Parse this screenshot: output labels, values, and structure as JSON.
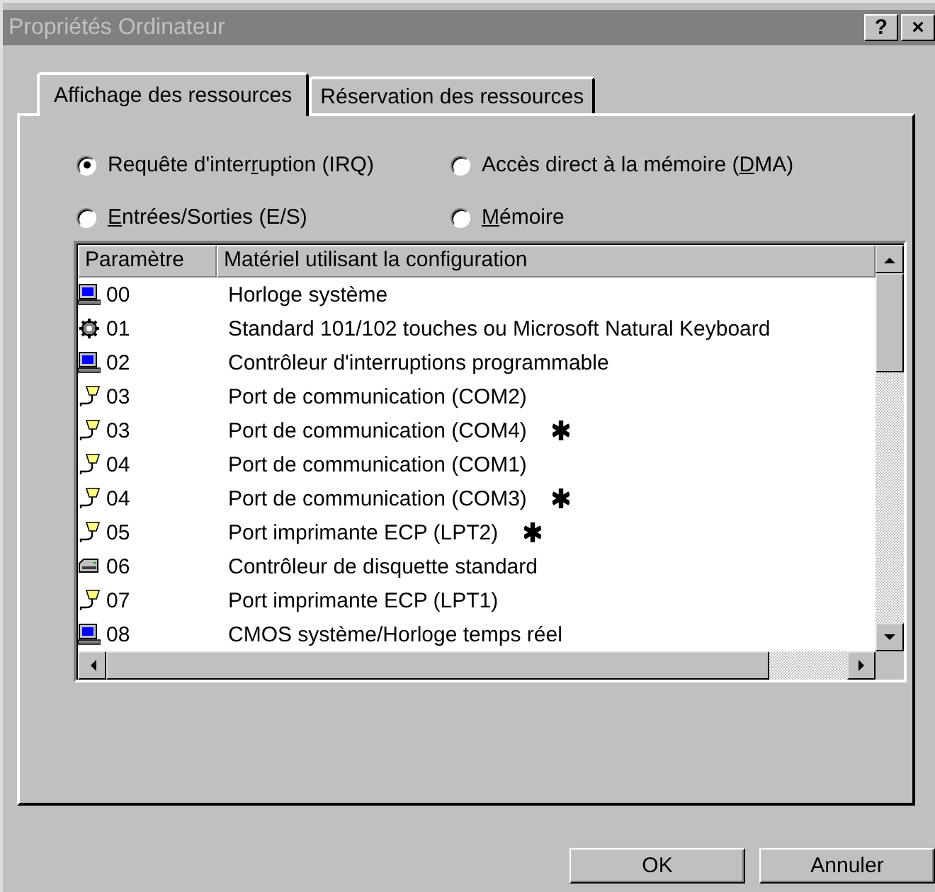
{
  "window": {
    "title": "Propriétés Ordinateur",
    "help_button": "?",
    "close_button": "×"
  },
  "tabs": [
    {
      "label": "Affichage des ressources",
      "selected": true
    },
    {
      "label": "Réservation des ressources",
      "selected": false
    }
  ],
  "options": [
    {
      "before": "Requête d'inter",
      "key": "r",
      "after": "uption (IRQ)",
      "selected": true
    },
    {
      "before": "Accès direct à la mémoire (",
      "key": "D",
      "after": "MA)",
      "selected": false
    },
    {
      "key": "E",
      "after": "ntrées/Sorties (E/S)",
      "selected": false
    },
    {
      "key": "M",
      "after": "émoire",
      "selected": false
    }
  ],
  "table": {
    "columns": [
      "Paramètre",
      "Matériel utilisant la configuration"
    ],
    "rows": [
      {
        "kind": "computer",
        "setting": "00",
        "device": "Horloge système",
        "conflict": false
      },
      {
        "kind": "keyboard",
        "setting": "01",
        "device": "Standard 101/102 touches ou Microsoft Natural Keyboard",
        "conflict": false
      },
      {
        "kind": "computer",
        "setting": "02",
        "device": "Contrôleur d'interruptions programmable",
        "conflict": false
      },
      {
        "kind": "port",
        "setting": "03",
        "device": "Port de communication (COM2)",
        "conflict": false
      },
      {
        "kind": "port",
        "setting": "03",
        "device": "Port de communication (COM4)",
        "conflict": true
      },
      {
        "kind": "port",
        "setting": "04",
        "device": "Port de communication (COM1)",
        "conflict": false
      },
      {
        "kind": "port",
        "setting": "04",
        "device": "Port de communication (COM3)",
        "conflict": true
      },
      {
        "kind": "port",
        "setting": "05",
        "device": "Port imprimante ECP (LPT2)",
        "conflict": true
      },
      {
        "kind": "floppy",
        "setting": "06",
        "device": "Contrôleur de disquette standard",
        "conflict": false
      },
      {
        "kind": "port",
        "setting": "07",
        "device": "Port imprimante ECP (LPT1)",
        "conflict": false
      },
      {
        "kind": "computer",
        "setting": "08",
        "device": "CMOS système/Horloge temps réel",
        "conflict": false
      }
    ]
  },
  "buttons": [
    "OK",
    "Annuler"
  ]
}
